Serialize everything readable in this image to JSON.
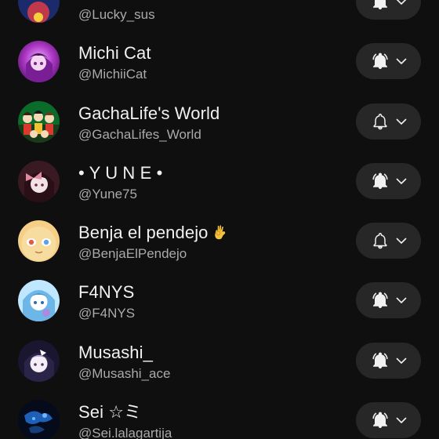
{
  "channels": [
    {
      "name": "",
      "handle": "@Lucky_sus",
      "bell": "bell-ringing-icon",
      "avatar_colors": [
        "#1b2a6b",
        "#c0394b",
        "#f4d03f"
      ]
    },
    {
      "name": "Michi Cat",
      "handle": "@MichiiCat",
      "bell": "bell-ringing-icon",
      "avatar_colors": [
        "#b03ac8",
        "#e9b7ff",
        "#5a1470"
      ]
    },
    {
      "name": "GachaLife's World",
      "handle": "@GachaLifes_World",
      "bell": "bell-outline-icon",
      "avatar_colors": [
        "#0b6b2a",
        "#d93a2b",
        "#f5d9b8"
      ]
    },
    {
      "name": "• Y U N E •",
      "handle": "@Yune75",
      "bell": "bell-ringing-icon",
      "avatar_colors": [
        "#3a1a22",
        "#e38aa3",
        "#f3e3e8"
      ]
    },
    {
      "name": "Benja el pendejo",
      "name_emoji": "ok-hand-emoji",
      "handle": "@BenjaElPendejo",
      "bell": "bell-outline-icon",
      "avatar_colors": [
        "#f5cf86",
        "#e05b4a",
        "#5aa3e6"
      ]
    },
    {
      "name": "F4NYS",
      "handle": "@F4NYS",
      "bell": "bell-ringing-icon",
      "avatar_colors": [
        "#bfe7ff",
        "#6db7e8",
        "#ffffff"
      ]
    },
    {
      "name": "Musashi_",
      "handle": "@Musashi_ace",
      "bell": "bell-ringing-icon",
      "avatar_colors": [
        "#1a1630",
        "#b9a5d8",
        "#f6eef7"
      ]
    },
    {
      "name": "Sei ☆ミ",
      "handle": "@Sei.lalagartija",
      "bell": "bell-ringing-icon",
      "avatar_colors": [
        "#050b1a",
        "#1e5fb8",
        "#6fb6ff"
      ]
    }
  ],
  "theme": {
    "background": "#0f0f0f",
    "button_background": "#272727",
    "primary_text": "#f1f1f1",
    "secondary_text": "#aaaaaa"
  }
}
